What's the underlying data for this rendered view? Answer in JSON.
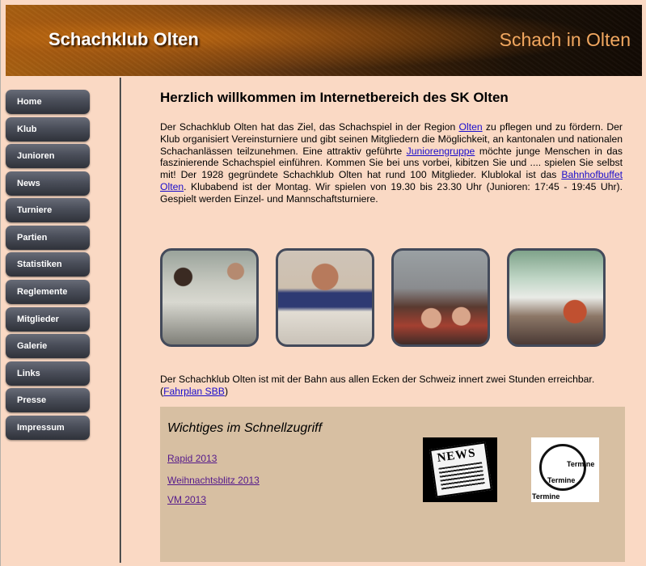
{
  "header": {
    "site_title": "Schachklub Olten",
    "tagline": "Schach in Olten"
  },
  "sidebar": {
    "items": [
      {
        "label": "Home"
      },
      {
        "label": "Klub"
      },
      {
        "label": "Junioren"
      },
      {
        "label": "News"
      },
      {
        "label": "Turniere"
      },
      {
        "label": "Partien"
      },
      {
        "label": "Statistiken"
      },
      {
        "label": "Reglemente"
      },
      {
        "label": "Mitglieder"
      },
      {
        "label": "Galerie"
      },
      {
        "label": "Links"
      },
      {
        "label": "Presse"
      },
      {
        "label": "Impressum"
      }
    ]
  },
  "main": {
    "heading": "Herzlich willkommen im Internetbereich des SK Olten",
    "intro": {
      "t1": "Der Schachklub Olten hat das Ziel, das Schachspiel in der Region ",
      "link_olten": "Olten",
      "t2": " zu pflegen und zu fördern. Der Klub organisiert Vereinsturniere und gibt seinen Mitgliedern die Möglichkeit, an kantonalen und nationalen Schachanlässen teilzunehmen. Eine attraktiv geführte ",
      "link_junioren": "Juniorengruppe",
      "t3": " möchte junge Menschen in das faszinierende Schachspiel einführen. Kommen Sie bei uns vorbei,  kibitzen Sie und .... spielen Sie selbst mit! Der 1928 gegründete Schachklub Olten hat rund 100 Mitglieder. Klublokal ist das ",
      "link_bahnhof": "Bahnhofbuffet Olten",
      "t4": ". Klubabend ist der Montag. Wir spielen von 19.30 bis 23.30 Uhr (Junioren: 17:45 - 19:45 Uhr). Gespielt werden Einzel- und Mannschaftsturniere."
    },
    "rail": {
      "t1": "Der Schachklub Olten ist mit der Bahn aus allen Ecken der Schweiz innert zwei Stunden erreichbar. (",
      "link": "Fahrplan SBB",
      "t2": ")"
    }
  },
  "quick": {
    "heading": "Wichtiges im Schnellzugriff",
    "links": [
      {
        "label": "Rapid 2013"
      },
      {
        "label": "Weihnachtsblitz 2013"
      },
      {
        "label": "VM 2013"
      }
    ],
    "news_image_text": "NEWS",
    "termine_image_text": [
      "Termine",
      "Termine",
      "Termine"
    ]
  },
  "colors": {
    "page_background": "#fad9c4",
    "panel_background": "#d7bfa2",
    "nav_button": "#4a4e59",
    "tagline": "#f2a860",
    "link": "#1a0dcc",
    "visited_link": "#551a8b"
  }
}
